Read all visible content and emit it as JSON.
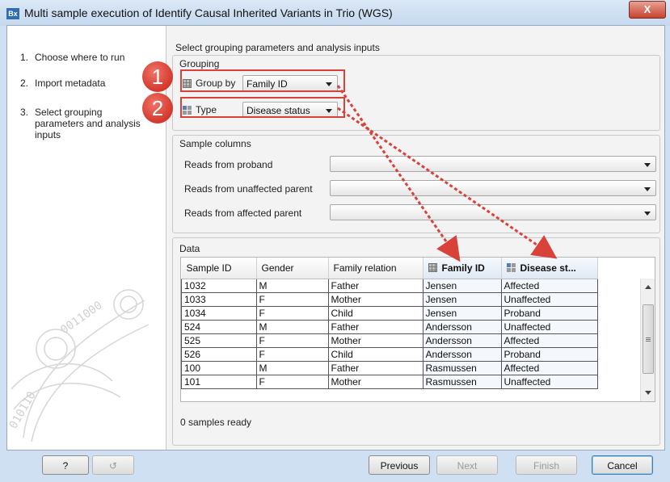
{
  "window": {
    "icon_text": "Bx",
    "title": "Multi sample execution of Identify Causal Inherited Variants in Trio (WGS)",
    "close_label": "X"
  },
  "steps": [
    {
      "num": "1.",
      "label": "Choose where to run"
    },
    {
      "num": "2.",
      "label": "Import metadata"
    },
    {
      "num": "3.",
      "label": "Select grouping parameters and analysis inputs"
    }
  ],
  "heading": "Select grouping parameters and analysis inputs",
  "grouping": {
    "title": "Grouping",
    "group_by_label": "Group by",
    "group_by_value": "Family ID",
    "type_label": "Type",
    "type_value": "Disease status"
  },
  "badges": [
    "1",
    "2"
  ],
  "sample_columns": {
    "title": "Sample columns",
    "rows": [
      {
        "label": "Reads from proband",
        "value": ""
      },
      {
        "label": "Reads from unaffected parent",
        "value": ""
      },
      {
        "label": "Reads from affected parent",
        "value": ""
      }
    ]
  },
  "data": {
    "title": "Data",
    "columns": [
      "Sample ID",
      "Gender",
      "Family relation",
      "Family ID",
      "Disease st..."
    ],
    "rows": [
      [
        "1032",
        "M",
        "Father",
        "Jensen",
        "Affected"
      ],
      [
        "1033",
        "F",
        "Mother",
        "Jensen",
        "Unaffected"
      ],
      [
        "1034",
        "F",
        "Child",
        "Jensen",
        "Proband"
      ],
      [
        "524",
        "M",
        "Father",
        "Andersson",
        "Unaffected"
      ],
      [
        "525",
        "F",
        "Mother",
        "Andersson",
        "Affected"
      ],
      [
        "526",
        "F",
        "Child",
        "Andersson",
        "Proband"
      ],
      [
        "100",
        "M",
        "Father",
        "Rasmussen",
        "Affected"
      ],
      [
        "101",
        "F",
        "Mother",
        "Rasmussen",
        "Unaffected"
      ]
    ],
    "status": "0 samples ready"
  },
  "buttons": {
    "help": "?",
    "previous": "Previous",
    "next": "Next",
    "finish": "Finish",
    "cancel": "Cancel"
  },
  "colors": {
    "annotation_red": "#d9423a",
    "titlebar": "#c4d8ee"
  }
}
